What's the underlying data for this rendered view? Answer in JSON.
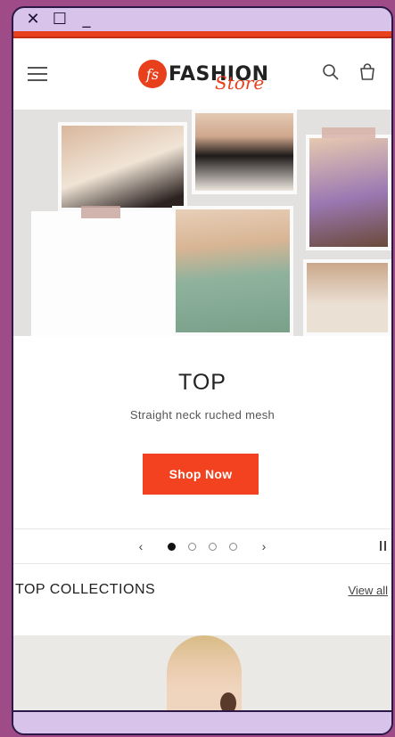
{
  "window": {
    "close_glyph": "✕",
    "maximize_glyph": "☐",
    "minimize_glyph": "_"
  },
  "header": {
    "logo_mark": "fs",
    "logo_text": "FASHION",
    "logo_script": "Store"
  },
  "slide": {
    "title": "TOP",
    "subtitle": "Straight neck ruched mesh",
    "button_label": "Shop Now",
    "prev_glyph": "‹",
    "next_glyph": "›",
    "dots_count": 4,
    "active_dot": 1
  },
  "collections": {
    "title": "TOP COLLECTIONS",
    "view_all": "View all"
  },
  "colors": {
    "accent": "#f2421f",
    "frame": "#d8c4ea",
    "border": "#2b1846",
    "background": "#9e4b87"
  },
  "icons": [
    "menu-icon",
    "search-icon",
    "cart-icon",
    "pause-icon",
    "chevron-left-icon",
    "chevron-right-icon"
  ]
}
